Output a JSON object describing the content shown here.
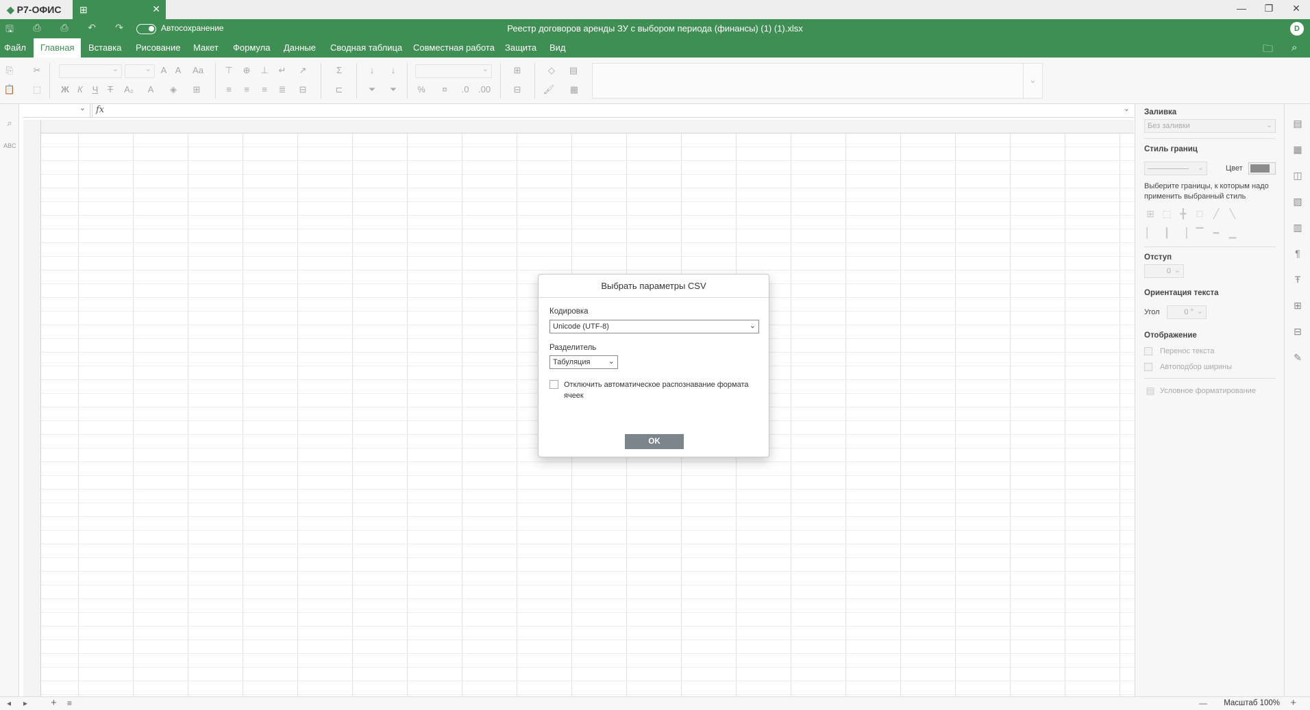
{
  "app": {
    "name": "Р7-ОФИС"
  },
  "tabs": [
    {
      "icon": "spreadsheet-icon",
      "close": "✕"
    }
  ],
  "window": {
    "minimize": "—",
    "restore": "❐",
    "close": "✕"
  },
  "titlebar": {
    "autosave_label": "Автосохранение",
    "autosave_on": true,
    "doc_title": "Реестр договоров аренды ЗУ с выбором периода (финансы) (1) (1).xlsx",
    "user_initial": "D"
  },
  "menu": {
    "items": [
      "Файл",
      "Главная",
      "Вставка",
      "Рисование",
      "Макет",
      "Формула",
      "Данные",
      "Сводная таблица",
      "Совместная работа",
      "Защита",
      "Вид"
    ],
    "active": "Главная"
  },
  "formula_bar": {
    "fx": "fx"
  },
  "right_panel": {
    "fill_title": "Заливка",
    "fill_value": "Без заливки",
    "border_style_title": "Стиль границ",
    "color_label": "Цвет",
    "border_color": "#8c8c8c",
    "border_hint": "Выберите границы, к которым надо применить выбранный стиль",
    "indent_title": "Отступ",
    "indent_value": "0",
    "orientation_title": "Ориентация текста",
    "angle_label": "Угол",
    "angle_value": "0 °",
    "display_title": "Отображение",
    "wrap_text": "Перенос текста",
    "autofit_width": "Автоподбор ширины",
    "conditional_format": "Условное форматирование"
  },
  "status_bar": {
    "zoom": "Масштаб 100%",
    "zoom_minus": "—",
    "zoom_plus": "+"
  },
  "dialog": {
    "title": "Выбрать параметры CSV",
    "encoding_label": "Кодировка",
    "encoding_value": "Unicode (UTF-8)",
    "delimiter_label": "Разделитель",
    "delimiter_value": "Табуляция",
    "disable_autodetect_label": "Отключить автоматическое распознавание формата ячеек",
    "disable_autodetect_checked": false,
    "ok_label": "OK"
  },
  "colors": {
    "brand": "#3f8e54",
    "ok_button": "#7d858c"
  }
}
